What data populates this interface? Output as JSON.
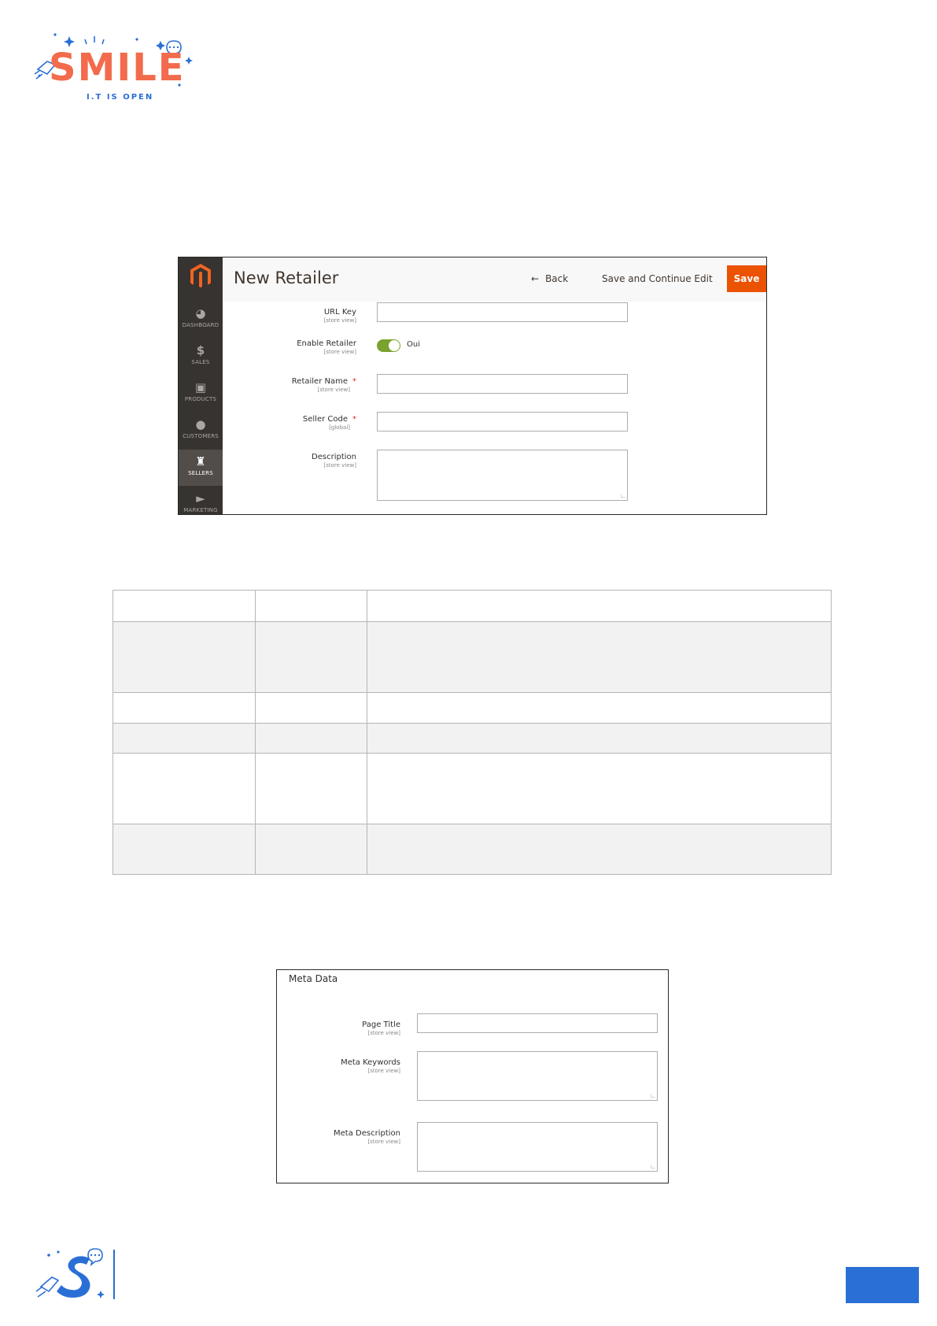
{
  "brand": {
    "wordmark": "SMILE",
    "tagline": "I.T IS OPEN",
    "primary_color": "#f26b4c",
    "secondary_color": "#2a6fd6"
  },
  "retailer_screen": {
    "page_title": "New Retailer",
    "back_label": "Back",
    "save_continue_label": "Save and Continue Edit",
    "save_label": "Save",
    "accent_color": "#eb5202",
    "sidebar": [
      {
        "label": "DASHBOARD",
        "icon": "gauge-icon"
      },
      {
        "label": "SALES",
        "icon": "dollar-icon"
      },
      {
        "label": "PRODUCTS",
        "icon": "box-icon"
      },
      {
        "label": "CUSTOMERS",
        "icon": "person-icon"
      },
      {
        "label": "SELLERS",
        "icon": "store-icon"
      },
      {
        "label": "MARKETING",
        "icon": "megaphone-icon"
      }
    ],
    "fields": {
      "url_key": {
        "label": "URL Key",
        "scope": "[store view]",
        "value": ""
      },
      "enable_retailer": {
        "label": "Enable Retailer",
        "scope": "[store view]",
        "state": "Oui"
      },
      "retailer_name": {
        "label": "Retailer Name",
        "scope": "[store view]",
        "value": "",
        "required": "*"
      },
      "seller_code": {
        "label": "Seller Code",
        "scope": "[global]",
        "value": "",
        "required": "*"
      },
      "description": {
        "label": "Description",
        "scope": "[store view]",
        "value": ""
      }
    }
  },
  "meta_screen": {
    "section_title": "Meta Data",
    "fields": {
      "page_title": {
        "label": "Page Title",
        "scope": "[store view]",
        "value": ""
      },
      "meta_keywords": {
        "label": "Meta Keywords",
        "scope": "[store view]",
        "value": ""
      },
      "meta_description": {
        "label": "Meta Description",
        "scope": "[store view]",
        "value": ""
      }
    }
  },
  "footer": {
    "page_number": ""
  }
}
